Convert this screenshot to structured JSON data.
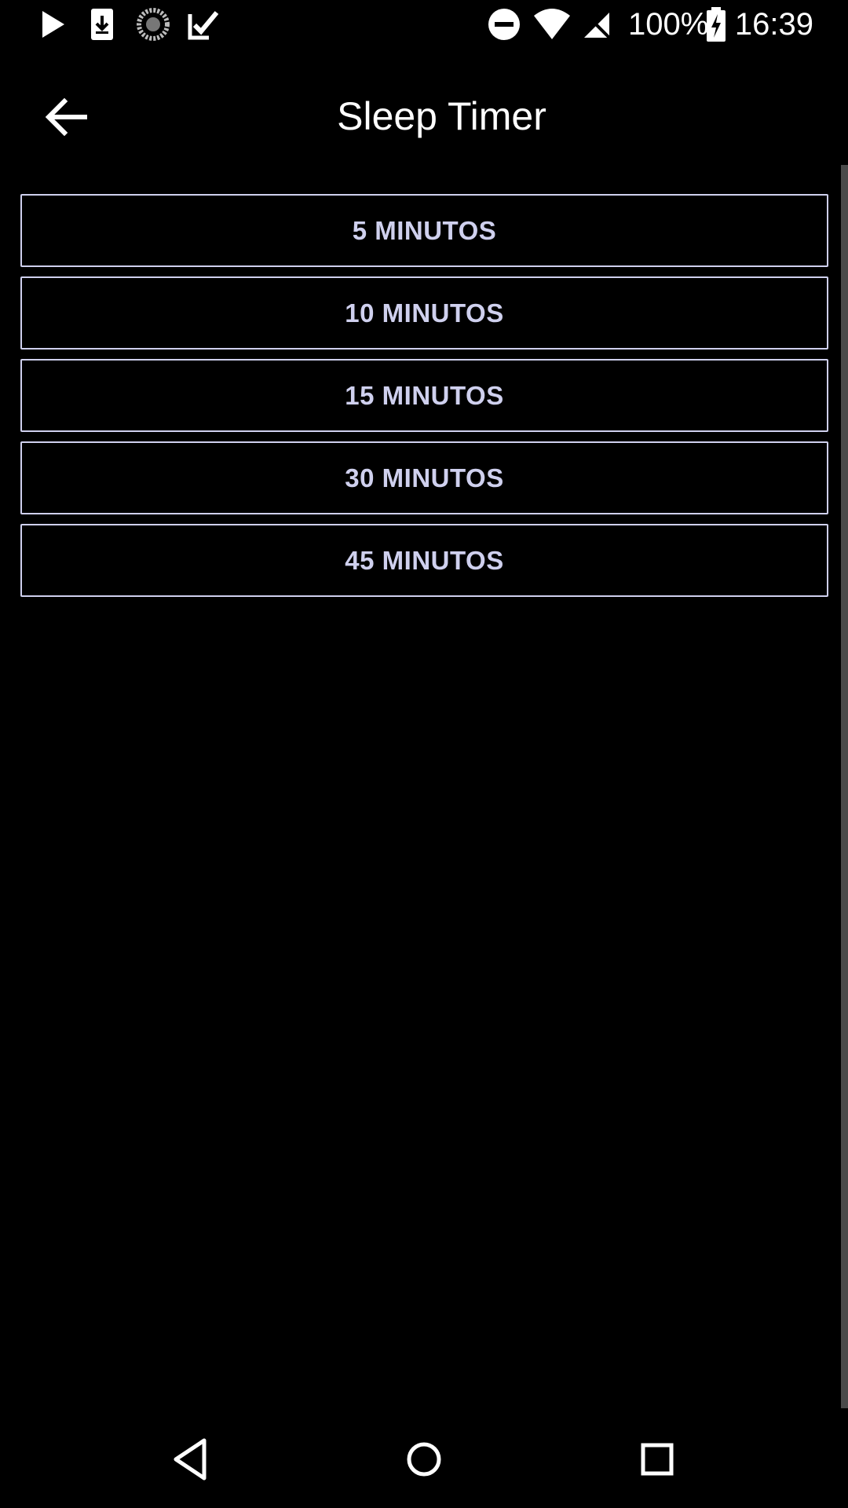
{
  "status_bar": {
    "icons_left": [
      "play-store-icon",
      "download-icon",
      "sync-spinner-icon",
      "checklist-icon"
    ],
    "icons_right": [
      "do-not-disturb-icon",
      "wifi-icon",
      "no-signal-icon",
      "battery-charging-icon"
    ],
    "battery_percent": "100%",
    "time": "16:39"
  },
  "toolbar": {
    "back_icon": "arrow-left-icon",
    "title": "Sleep Timer"
  },
  "options": [
    {
      "label": "5 MINUTOS"
    },
    {
      "label": "10 MINUTOS"
    },
    {
      "label": "15 MINUTOS"
    },
    {
      "label": "30 MINUTOS"
    },
    {
      "label": "45 MINUTOS"
    }
  ],
  "nav_bar": {
    "back": "nav-back-icon",
    "home": "nav-home-icon",
    "recents": "nav-recents-icon"
  },
  "colors": {
    "background": "#000000",
    "button_border": "#cfd0ee",
    "button_text": "#cfd0ee",
    "scroll_track": "#4a4a4a"
  }
}
